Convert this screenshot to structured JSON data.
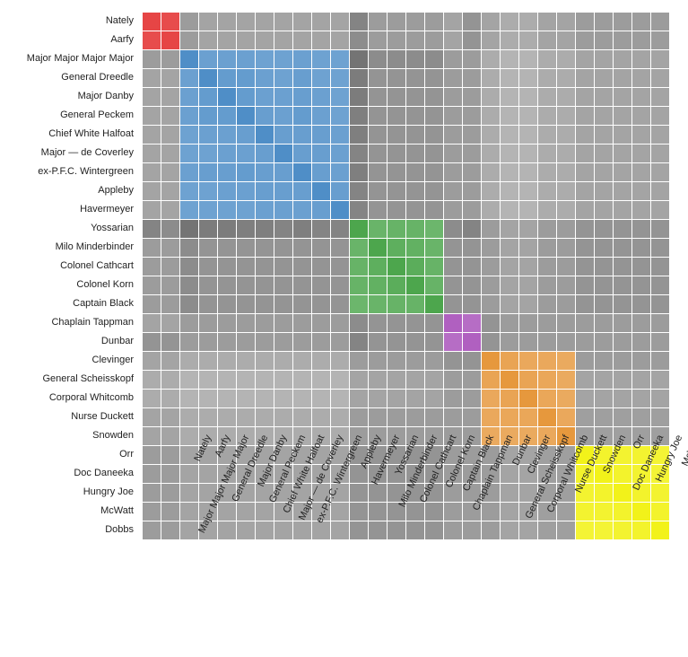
{
  "chart_data": {
    "type": "heatmap",
    "title": "",
    "xlabel": "",
    "ylabel": "",
    "labels": [
      "Nately",
      "Aarfy",
      "Major Major Major Major",
      "General Dreedle",
      "Major Danby",
      "General Peckem",
      "Chief White Halfoat",
      "Major — de Coverley",
      "ex-P.F.C. Wintergreen",
      "Appleby",
      "Havermeyer",
      "Yossarian",
      "Milo Minderbinder",
      "Colonel Cathcart",
      "Colonel Korn",
      "Captain Black",
      "Chaplain Tappman",
      "Dunbar",
      "Clevinger",
      "General Scheisskopf",
      "Corporal Whitcomb",
      "Nurse Duckett",
      "Snowden",
      "Orr",
      "Doc Daneeka",
      "Hungry Joe",
      "McWatt",
      "Dobbs"
    ],
    "clusters": [
      {
        "name": "red",
        "members": [
          0,
          1
        ],
        "color": "#e64545"
      },
      {
        "name": "blue",
        "members": [
          2,
          3,
          4,
          5,
          6,
          7,
          8,
          9,
          10
        ],
        "color": "#4f8ec7"
      },
      {
        "name": "green",
        "members": [
          11,
          12,
          13,
          14,
          15
        ],
        "color": "#4da64d"
      },
      {
        "name": "purple",
        "members": [
          16,
          17
        ],
        "color": "#b060c0"
      },
      {
        "name": "orange",
        "members": [
          18,
          19,
          20,
          21,
          22
        ],
        "color": "#e6983d"
      },
      {
        "name": "yellow",
        "members": [
          23,
          24,
          25,
          26,
          27
        ],
        "color": "#f2f21a"
      }
    ],
    "matrix": [
      [
        1.0,
        0.95,
        0.4,
        0.35,
        0.35,
        0.35,
        0.35,
        0.35,
        0.35,
        0.35,
        0.35,
        0.55,
        0.4,
        0.4,
        0.4,
        0.4,
        0.35,
        0.45,
        0.35,
        0.3,
        0.3,
        0.35,
        0.35,
        0.4,
        0.4,
        0.4,
        0.4,
        0.4
      ],
      [
        0.95,
        1.0,
        0.4,
        0.35,
        0.35,
        0.35,
        0.35,
        0.35,
        0.35,
        0.35,
        0.35,
        0.5,
        0.4,
        0.4,
        0.4,
        0.4,
        0.35,
        0.45,
        0.35,
        0.3,
        0.3,
        0.35,
        0.35,
        0.4,
        0.4,
        0.4,
        0.4,
        0.4
      ],
      [
        0.4,
        0.4,
        1.0,
        0.8,
        0.8,
        0.8,
        0.78,
        0.78,
        0.8,
        0.78,
        0.78,
        0.65,
        0.5,
        0.5,
        0.5,
        0.5,
        0.4,
        0.4,
        0.3,
        0.25,
        0.25,
        0.3,
        0.3,
        0.35,
        0.35,
        0.35,
        0.35,
        0.35
      ],
      [
        0.35,
        0.35,
        0.8,
        1.0,
        0.85,
        0.85,
        0.8,
        0.78,
        0.82,
        0.78,
        0.78,
        0.6,
        0.45,
        0.45,
        0.45,
        0.45,
        0.4,
        0.4,
        0.3,
        0.25,
        0.25,
        0.3,
        0.3,
        0.35,
        0.35,
        0.35,
        0.35,
        0.35
      ],
      [
        0.35,
        0.35,
        0.8,
        0.85,
        1.0,
        0.85,
        0.8,
        0.8,
        0.82,
        0.8,
        0.78,
        0.6,
        0.45,
        0.45,
        0.45,
        0.45,
        0.4,
        0.4,
        0.3,
        0.25,
        0.25,
        0.3,
        0.3,
        0.35,
        0.35,
        0.35,
        0.35,
        0.35
      ],
      [
        0.35,
        0.35,
        0.8,
        0.85,
        0.85,
        1.0,
        0.82,
        0.8,
        0.85,
        0.8,
        0.78,
        0.58,
        0.45,
        0.45,
        0.45,
        0.45,
        0.4,
        0.4,
        0.3,
        0.25,
        0.25,
        0.3,
        0.3,
        0.35,
        0.35,
        0.35,
        0.35,
        0.35
      ],
      [
        0.35,
        0.35,
        0.78,
        0.8,
        0.8,
        0.82,
        1.0,
        0.82,
        0.82,
        0.82,
        0.8,
        0.58,
        0.45,
        0.45,
        0.45,
        0.45,
        0.4,
        0.4,
        0.3,
        0.25,
        0.25,
        0.3,
        0.3,
        0.35,
        0.35,
        0.35,
        0.35,
        0.35
      ],
      [
        0.35,
        0.35,
        0.78,
        0.78,
        0.8,
        0.8,
        0.82,
        1.0,
        0.82,
        0.82,
        0.8,
        0.55,
        0.45,
        0.45,
        0.45,
        0.45,
        0.4,
        0.4,
        0.3,
        0.25,
        0.25,
        0.3,
        0.3,
        0.35,
        0.35,
        0.35,
        0.35,
        0.35
      ],
      [
        0.35,
        0.35,
        0.8,
        0.82,
        0.82,
        0.85,
        0.82,
        0.82,
        1.0,
        0.82,
        0.8,
        0.58,
        0.45,
        0.45,
        0.45,
        0.45,
        0.4,
        0.4,
        0.3,
        0.25,
        0.25,
        0.3,
        0.3,
        0.35,
        0.35,
        0.35,
        0.35,
        0.35
      ],
      [
        0.35,
        0.35,
        0.78,
        0.78,
        0.8,
        0.8,
        0.82,
        0.82,
        0.82,
        1.0,
        0.82,
        0.55,
        0.45,
        0.45,
        0.45,
        0.45,
        0.4,
        0.4,
        0.3,
        0.25,
        0.25,
        0.3,
        0.3,
        0.35,
        0.35,
        0.35,
        0.35,
        0.35
      ],
      [
        0.35,
        0.35,
        0.78,
        0.78,
        0.78,
        0.78,
        0.8,
        0.8,
        0.8,
        0.82,
        1.0,
        0.55,
        0.45,
        0.45,
        0.45,
        0.45,
        0.4,
        0.4,
        0.3,
        0.25,
        0.25,
        0.3,
        0.3,
        0.35,
        0.35,
        0.35,
        0.35,
        0.35
      ],
      [
        0.55,
        0.5,
        0.65,
        0.6,
        0.6,
        0.58,
        0.58,
        0.55,
        0.58,
        0.55,
        0.55,
        1.0,
        0.8,
        0.82,
        0.82,
        0.78,
        0.5,
        0.55,
        0.4,
        0.35,
        0.35,
        0.4,
        0.4,
        0.45,
        0.45,
        0.45,
        0.45,
        0.45
      ],
      [
        0.4,
        0.4,
        0.5,
        0.45,
        0.45,
        0.45,
        0.45,
        0.45,
        0.45,
        0.45,
        0.45,
        0.8,
        1.0,
        0.88,
        0.85,
        0.8,
        0.45,
        0.45,
        0.4,
        0.35,
        0.35,
        0.4,
        0.4,
        0.45,
        0.45,
        0.45,
        0.45,
        0.45
      ],
      [
        0.4,
        0.4,
        0.5,
        0.45,
        0.45,
        0.45,
        0.45,
        0.45,
        0.45,
        0.45,
        0.45,
        0.82,
        0.88,
        1.0,
        0.9,
        0.82,
        0.45,
        0.45,
        0.4,
        0.35,
        0.35,
        0.4,
        0.4,
        0.45,
        0.45,
        0.45,
        0.45,
        0.45
      ],
      [
        0.4,
        0.4,
        0.5,
        0.45,
        0.45,
        0.45,
        0.45,
        0.45,
        0.45,
        0.45,
        0.45,
        0.82,
        0.85,
        0.9,
        1.0,
        0.82,
        0.45,
        0.45,
        0.4,
        0.35,
        0.35,
        0.4,
        0.4,
        0.45,
        0.45,
        0.45,
        0.45,
        0.45
      ],
      [
        0.4,
        0.4,
        0.5,
        0.45,
        0.45,
        0.45,
        0.45,
        0.45,
        0.45,
        0.45,
        0.45,
        0.78,
        0.8,
        0.82,
        0.82,
        1.0,
        0.45,
        0.45,
        0.4,
        0.35,
        0.35,
        0.4,
        0.4,
        0.45,
        0.45,
        0.45,
        0.45,
        0.45
      ],
      [
        0.35,
        0.35,
        0.4,
        0.4,
        0.4,
        0.4,
        0.4,
        0.4,
        0.4,
        0.4,
        0.4,
        0.5,
        0.45,
        0.45,
        0.45,
        0.45,
        1.0,
        0.9,
        0.45,
        0.4,
        0.4,
        0.4,
        0.4,
        0.4,
        0.4,
        0.4,
        0.4,
        0.4
      ],
      [
        0.45,
        0.45,
        0.4,
        0.4,
        0.4,
        0.4,
        0.4,
        0.4,
        0.4,
        0.4,
        0.4,
        0.55,
        0.45,
        0.45,
        0.45,
        0.45,
        0.9,
        1.0,
        0.45,
        0.4,
        0.4,
        0.4,
        0.4,
        0.4,
        0.4,
        0.4,
        0.4,
        0.4
      ],
      [
        0.35,
        0.35,
        0.3,
        0.3,
        0.3,
        0.3,
        0.3,
        0.3,
        0.3,
        0.3,
        0.3,
        0.4,
        0.4,
        0.4,
        0.4,
        0.4,
        0.45,
        0.45,
        1.0,
        0.85,
        0.8,
        0.8,
        0.78,
        0.4,
        0.4,
        0.4,
        0.4,
        0.4
      ],
      [
        0.3,
        0.3,
        0.25,
        0.25,
        0.25,
        0.25,
        0.25,
        0.25,
        0.25,
        0.25,
        0.25,
        0.35,
        0.35,
        0.35,
        0.35,
        0.35,
        0.4,
        0.4,
        0.85,
        1.0,
        0.85,
        0.82,
        0.78,
        0.35,
        0.35,
        0.35,
        0.35,
        0.35
      ],
      [
        0.3,
        0.3,
        0.25,
        0.25,
        0.25,
        0.25,
        0.25,
        0.25,
        0.25,
        0.25,
        0.25,
        0.35,
        0.35,
        0.35,
        0.35,
        0.35,
        0.4,
        0.4,
        0.8,
        0.85,
        1.0,
        0.82,
        0.78,
        0.35,
        0.35,
        0.35,
        0.35,
        0.35
      ],
      [
        0.35,
        0.35,
        0.3,
        0.3,
        0.3,
        0.3,
        0.3,
        0.3,
        0.3,
        0.3,
        0.3,
        0.4,
        0.4,
        0.4,
        0.4,
        0.4,
        0.4,
        0.4,
        0.8,
        0.82,
        0.82,
        1.0,
        0.8,
        0.38,
        0.38,
        0.38,
        0.38,
        0.38
      ],
      [
        0.35,
        0.35,
        0.3,
        0.3,
        0.3,
        0.3,
        0.3,
        0.3,
        0.3,
        0.3,
        0.3,
        0.4,
        0.4,
        0.4,
        0.4,
        0.4,
        0.4,
        0.4,
        0.78,
        0.78,
        0.78,
        0.8,
        1.0,
        0.38,
        0.38,
        0.38,
        0.38,
        0.38
      ],
      [
        0.4,
        0.4,
        0.35,
        0.35,
        0.35,
        0.35,
        0.35,
        0.35,
        0.35,
        0.35,
        0.35,
        0.45,
        0.45,
        0.45,
        0.45,
        0.45,
        0.4,
        0.4,
        0.4,
        0.35,
        0.35,
        0.38,
        0.38,
        1.0,
        0.9,
        0.88,
        0.88,
        0.85
      ],
      [
        0.4,
        0.4,
        0.35,
        0.35,
        0.35,
        0.35,
        0.35,
        0.35,
        0.35,
        0.35,
        0.35,
        0.45,
        0.45,
        0.45,
        0.45,
        0.45,
        0.4,
        0.4,
        0.4,
        0.35,
        0.35,
        0.38,
        0.38,
        0.9,
        1.0,
        0.9,
        0.88,
        0.85
      ],
      [
        0.4,
        0.4,
        0.35,
        0.35,
        0.35,
        0.35,
        0.35,
        0.35,
        0.35,
        0.35,
        0.35,
        0.45,
        0.45,
        0.45,
        0.45,
        0.45,
        0.4,
        0.4,
        0.4,
        0.35,
        0.35,
        0.38,
        0.38,
        0.88,
        0.9,
        1.0,
        0.9,
        0.88
      ],
      [
        0.4,
        0.4,
        0.35,
        0.35,
        0.35,
        0.35,
        0.35,
        0.35,
        0.35,
        0.35,
        0.35,
        0.45,
        0.45,
        0.45,
        0.45,
        0.45,
        0.4,
        0.4,
        0.4,
        0.35,
        0.35,
        0.38,
        0.38,
        0.88,
        0.88,
        0.9,
        1.0,
        0.9
      ],
      [
        0.4,
        0.4,
        0.35,
        0.35,
        0.35,
        0.35,
        0.35,
        0.35,
        0.35,
        0.35,
        0.35,
        0.45,
        0.45,
        0.45,
        0.45,
        0.45,
        0.4,
        0.4,
        0.4,
        0.35,
        0.35,
        0.38,
        0.38,
        0.85,
        0.85,
        0.88,
        0.9,
        1.0
      ]
    ]
  }
}
